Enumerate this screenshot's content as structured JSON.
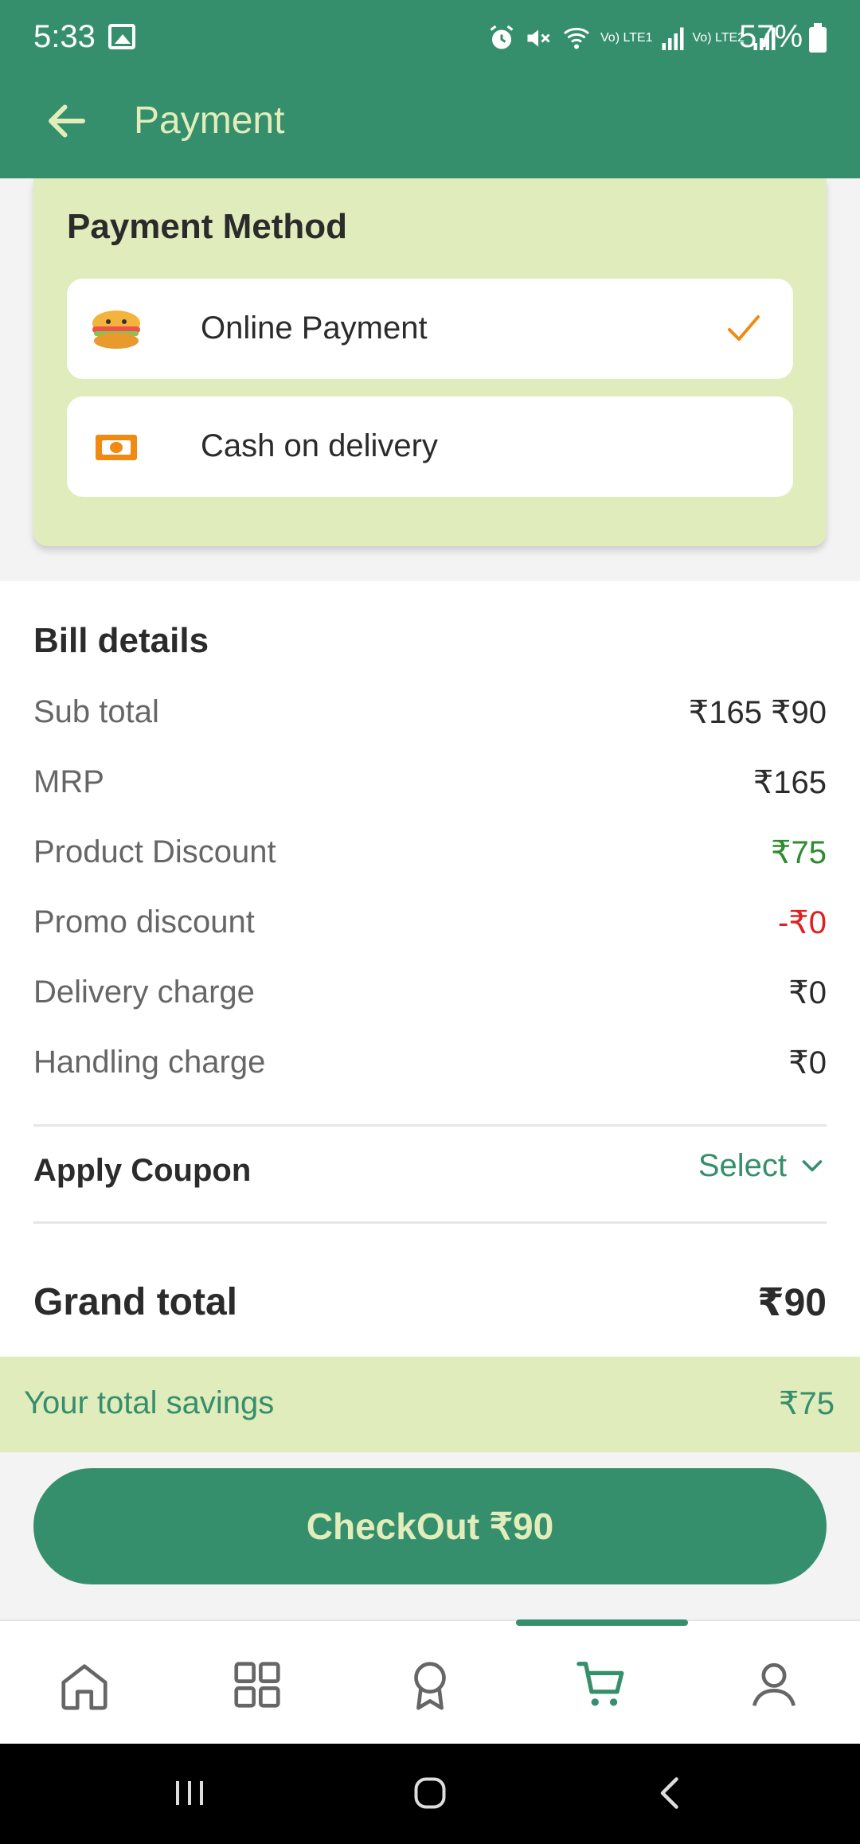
{
  "status_bar": {
    "time": "5:33",
    "battery_percent": "57%",
    "icons": [
      "gallery-icon",
      "alarm-icon",
      "mute-icon",
      "wifi-icon",
      "volte1-signal-icon",
      "volte2-signal-icon",
      "battery-icon"
    ],
    "volte1_label": "Vo) LTE1",
    "volte2_label": "Vo) LTE2"
  },
  "header": {
    "title": "Payment",
    "back_icon": "arrow-left-icon"
  },
  "payment_method": {
    "title": "Payment Method",
    "options": [
      {
        "label": "Online Payment",
        "icon": "online-payment-icon",
        "selected": true
      },
      {
        "label": "Cash on delivery",
        "icon": "cash-icon",
        "selected": false
      }
    ]
  },
  "bill": {
    "title": "Bill details",
    "rows": [
      {
        "label": "Sub total",
        "value": "₹165 ₹90",
        "color": "#2b2b2b"
      },
      {
        "label": "MRP",
        "value": "₹165",
        "color": "#2b2b2b"
      },
      {
        "label": "Product Discount",
        "value": "₹75",
        "color": "#2e8b2e"
      },
      {
        "label": "Promo discount",
        "value": "-₹0",
        "color": "#e02020"
      },
      {
        "label": "Delivery charge",
        "value": "₹0",
        "color": "#2b2b2b"
      },
      {
        "label": "Handling charge",
        "value": "₹0",
        "color": "#2b2b2b"
      }
    ],
    "coupon_label": "Apply Coupon",
    "coupon_select": "Select",
    "grand_total_label": "Grand total",
    "grand_total_value": "₹90"
  },
  "savings": {
    "label": "Your total savings",
    "value": "₹75"
  },
  "checkout": {
    "label": "CheckOut ₹90"
  },
  "bottom_nav": {
    "items": [
      "home-icon",
      "categories-grid-icon",
      "rewards-badge-icon",
      "cart-icon",
      "profile-icon"
    ],
    "active": "cart-icon"
  },
  "colors": {
    "primary": "#358f6c",
    "light_green": "#e1ecbc",
    "accent_orange": "#f08a12"
  }
}
